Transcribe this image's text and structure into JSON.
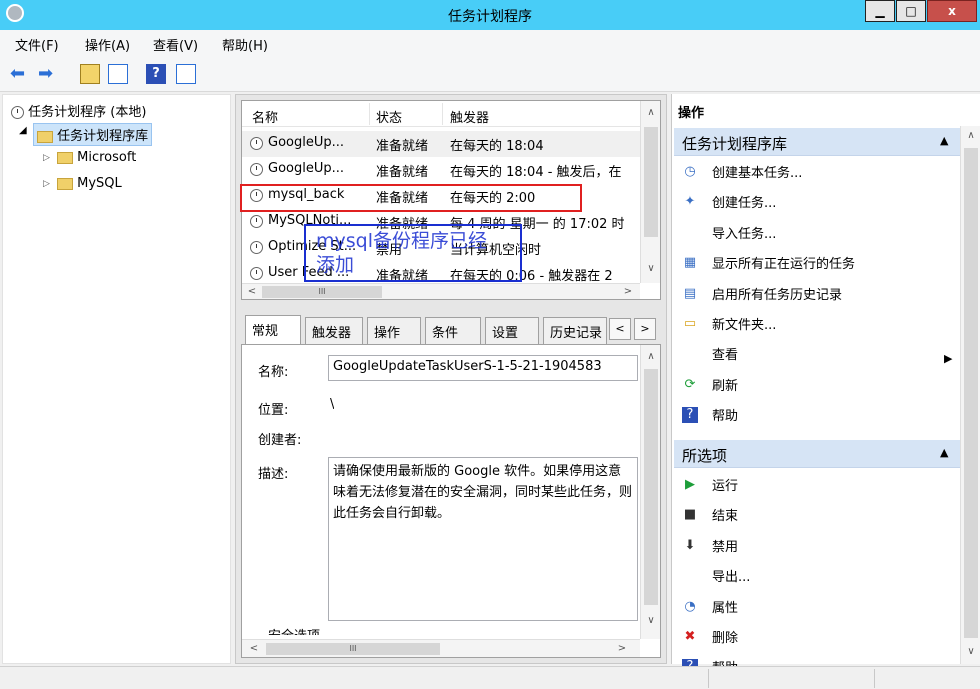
{
  "window": {
    "title": "任务计划程序",
    "min": "▁",
    "max": "□",
    "close": "x"
  },
  "menu": [
    "文件(F)",
    "操作(A)",
    "查看(V)",
    "帮助(H)"
  ],
  "tree": {
    "root": "任务计划程序 (本地)",
    "library": "任务计划程序库",
    "children": [
      "Microsoft",
      "MySQL"
    ]
  },
  "task_list": {
    "columns": [
      "名称",
      "状态",
      "触发器"
    ],
    "rows": [
      {
        "name": "GoogleUp...",
        "status": "准备就绪",
        "trigger": "在每天的 18:04"
      },
      {
        "name": "GoogleUp...",
        "status": "准备就绪",
        "trigger": "在每天的 18:04 - 触发后，在"
      },
      {
        "name": "mysql_back",
        "status": "准备就绪",
        "trigger": "在每天的 2:00"
      },
      {
        "name": "MySQLNoti...",
        "status": "准备就绪",
        "trigger": "每 4 周的 星期一 的 17:02 时"
      },
      {
        "name": "Optimize St...",
        "status": "禁用",
        "trigger": "当计算机空闲时"
      },
      {
        "name": "User Feed ...",
        "status": "准备就绪",
        "trigger": "在每天的 0:06 - 触发器在 2"
      }
    ],
    "hscroll_thumb": "III"
  },
  "annotation": "mysql备份程序已经添加",
  "tabs": [
    "常规",
    "触发器",
    "操作",
    "条件",
    "设置",
    "历史记录"
  ],
  "details": {
    "name_label": "名称:",
    "name_value": "GoogleUpdateTaskUserS-1-5-21-1904583",
    "location_label": "位置:",
    "location_value": "\\",
    "author_label": "创建者:",
    "desc_label": "描述:",
    "desc_value": "请确保使用最新版的 Google 软件。如果停用这意味着无法修复潜在的安全漏洞，同时某些此任务，则此任务会自行卸载。",
    "security_label": "安全选项",
    "hscroll_thumb": "III"
  },
  "actions": {
    "header": "操作",
    "section1_title": "任务计划程序库",
    "section1_items": [
      {
        "icon": "create-basic-task-icon",
        "glyph": "◷",
        "label": "创建基本任务..."
      },
      {
        "icon": "create-task-icon",
        "glyph": "✦",
        "label": "创建任务..."
      },
      {
        "icon": "",
        "glyph": "",
        "label": "导入任务..."
      },
      {
        "icon": "running-tasks-icon",
        "glyph": "▦",
        "label": "显示所有正在运行的任务"
      },
      {
        "icon": "history-icon",
        "glyph": "▤",
        "label": "启用所有任务历史记录"
      },
      {
        "icon": "new-folder-icon",
        "glyph": "▭",
        "label": "新文件夹..."
      },
      {
        "icon": "",
        "glyph": "",
        "label": "查看"
      },
      {
        "icon": "refresh-icon",
        "glyph": "⟳",
        "label": "刷新"
      },
      {
        "icon": "help-icon",
        "glyph": "?",
        "label": "帮助"
      }
    ],
    "section2_title": "所选项",
    "section2_items": [
      {
        "icon": "run-icon",
        "glyph": "▶",
        "label": "运行"
      },
      {
        "icon": "end-icon",
        "glyph": "■",
        "label": "结束"
      },
      {
        "icon": "disable-icon",
        "glyph": "⬇",
        "label": "禁用"
      },
      {
        "icon": "",
        "glyph": "",
        "label": "导出..."
      },
      {
        "icon": "properties-icon",
        "glyph": "◔",
        "label": "属性"
      },
      {
        "icon": "delete-icon",
        "glyph": "✖",
        "label": "删除"
      },
      {
        "icon": "help-icon",
        "glyph": "?",
        "label": "帮助"
      }
    ]
  },
  "colors": {
    "titlebar": "#48cdf7",
    "highlight_box": "#e02020",
    "annotation": "#1a2fd0"
  }
}
